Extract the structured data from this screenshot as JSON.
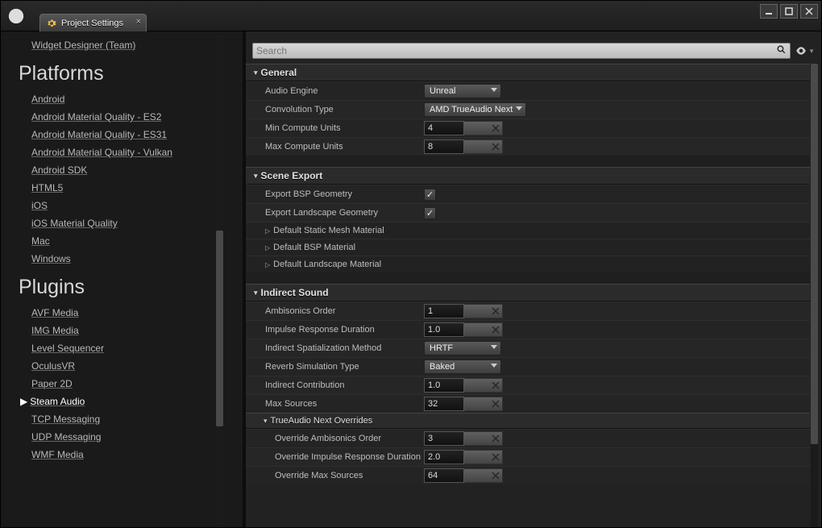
{
  "window": {
    "tab_title": "Project Settings",
    "search_placeholder": "Search"
  },
  "sidebar": {
    "top_item": "Widget Designer (Team)",
    "sections": [
      {
        "title": "Platforms",
        "items": [
          "Android",
          "Android Material Quality - ES2",
          "Android Material Quality - ES31",
          "Android Material Quality - Vulkan",
          "Android SDK",
          "HTML5",
          "iOS",
          "iOS Material Quality",
          "Mac",
          "Windows"
        ]
      },
      {
        "title": "Plugins",
        "items": [
          "AVF Media",
          "IMG Media",
          "Level Sequencer",
          "OculusVR",
          "Paper 2D",
          "Steam Audio",
          "TCP Messaging",
          "UDP Messaging",
          "WMF Media"
        ],
        "selected_index": 5
      }
    ]
  },
  "settings": {
    "general": {
      "title": "General",
      "audio_engine": {
        "label": "Audio Engine",
        "value": "Unreal"
      },
      "convolution_type": {
        "label": "Convolution Type",
        "value": "AMD TrueAudio Next"
      },
      "min_compute_units": {
        "label": "Min Compute Units",
        "value": "4"
      },
      "max_compute_units": {
        "label": "Max Compute Units",
        "value": "8"
      }
    },
    "scene_export": {
      "title": "Scene Export",
      "export_bsp": {
        "label": "Export BSP Geometry",
        "checked": true
      },
      "export_landscape": {
        "label": "Export Landscape Geometry",
        "checked": true
      },
      "default_static_mesh": {
        "label": "Default Static Mesh Material"
      },
      "default_bsp": {
        "label": "Default BSP Material"
      },
      "default_landscape": {
        "label": "Default Landscape Material"
      }
    },
    "indirect_sound": {
      "title": "Indirect Sound",
      "ambisonics_order": {
        "label": "Ambisonics Order",
        "value": "1"
      },
      "impulse_response_duration": {
        "label": "Impulse Response Duration",
        "value": "1.0"
      },
      "indirect_spatialization_method": {
        "label": "Indirect Spatialization Method",
        "value": "HRTF"
      },
      "reverb_simulation_type": {
        "label": "Reverb Simulation Type",
        "value": "Baked"
      },
      "indirect_contribution": {
        "label": "Indirect Contribution",
        "value": "1.0"
      },
      "max_sources": {
        "label": "Max Sources",
        "value": "32"
      },
      "tan_overrides": {
        "title": "TrueAudio Next Overrides",
        "override_ambisonics_order": {
          "label": "Override Ambisonics Order",
          "value": "3"
        },
        "override_impulse_response_duration": {
          "label": "Override Impulse Response Duration",
          "value": "2.0"
        },
        "override_max_sources": {
          "label": "Override Max Sources",
          "value": "64"
        }
      }
    }
  }
}
